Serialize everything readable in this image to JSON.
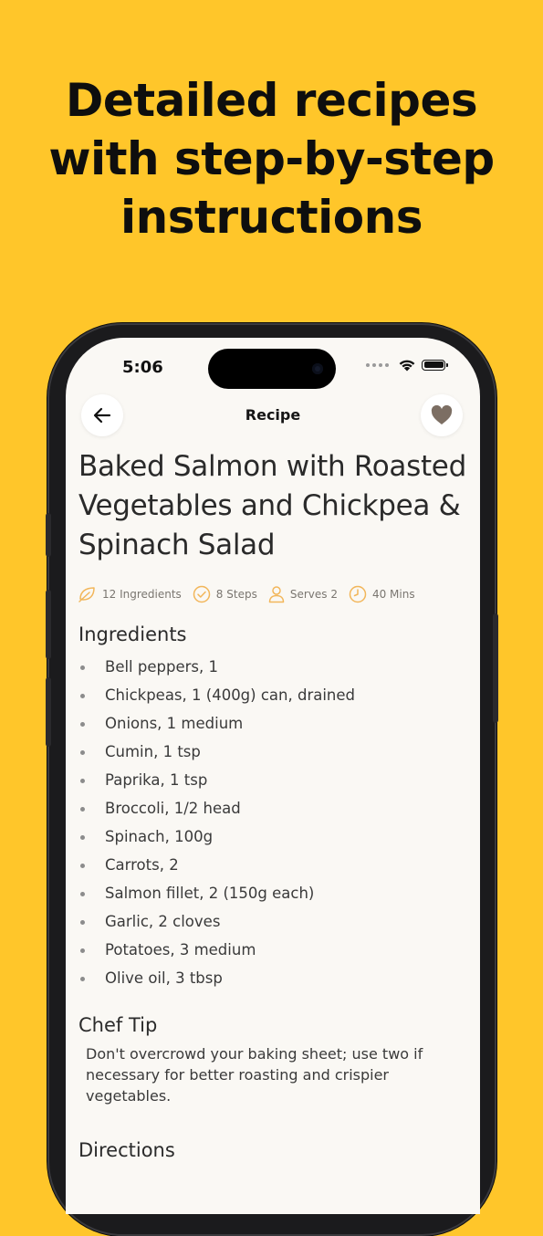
{
  "headline": {
    "line1": "Detailed recipes",
    "line2": "with step-by-step",
    "line3": "instructions"
  },
  "status_bar": {
    "time": "5:06"
  },
  "nav": {
    "title": "Recipe",
    "back_icon": "arrow-left-icon",
    "favorite_icon": "heart-icon"
  },
  "recipe": {
    "title": "Baked Salmon with Roasted Vegetables and Chickpea & Spinach Salad",
    "meta": {
      "ingredients": "12 Ingredients",
      "steps": "8 Steps",
      "serves": "Serves 2",
      "time": "40 Mins"
    }
  },
  "sections": {
    "ingredients_title": "Ingredients",
    "chef_tip_title": "Chef Tip",
    "directions_title": "Directions"
  },
  "ingredients": [
    "Bell peppers, 1",
    "Chickpeas, 1 (400g) can, drained",
    "Onions, 1 medium",
    "Cumin, 1 tsp",
    "Paprika, 1 tsp",
    "Broccoli, 1/2 head",
    "Spinach, 100g",
    "Carrots, 2",
    "Salmon fillet, 2 (150g each)",
    "Garlic, 2 cloves",
    "Potatoes, 3 medium",
    "Olive oil, 3 tbsp"
  ],
  "chef_tip": "Don't overcrowd your baking sheet; use two if necessary for better roasting and crispier vegetables.",
  "colors": {
    "background": "#FFC62A",
    "accent": "#F2B65A",
    "screen": "#FAF8F4",
    "heart": "#7C6E63"
  }
}
